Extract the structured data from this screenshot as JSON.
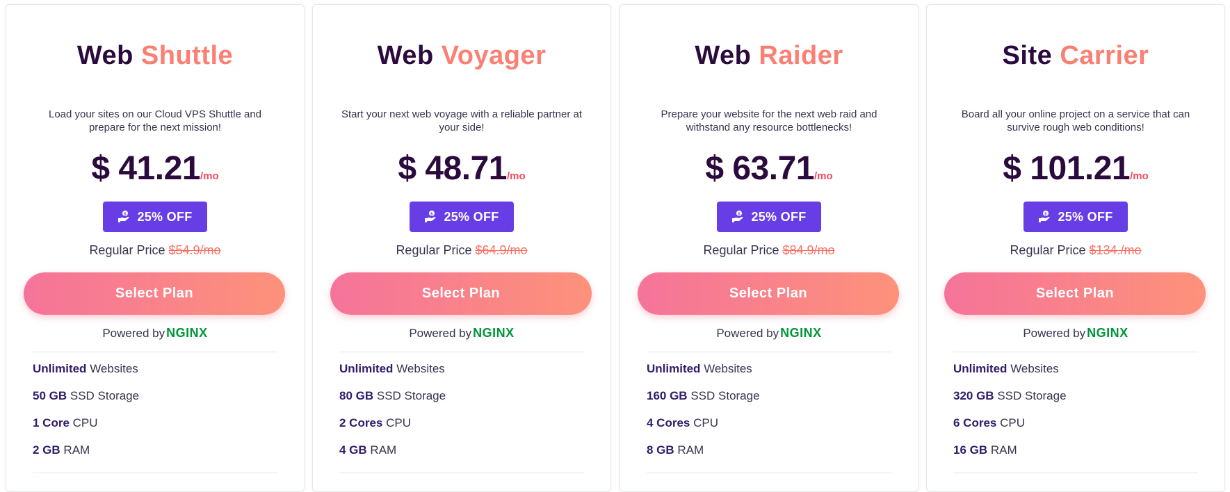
{
  "colors": {
    "title_dark": "#2b0a3d",
    "title_accent": "#fb7f72",
    "discount_bg": "#673de6",
    "select_gradient_start": "#f5739a",
    "select_gradient_end": "#fd927a",
    "nginx_green": "#009639",
    "strike_red": "#fb6f62"
  },
  "plans": [
    {
      "title_first": "Web",
      "title_accent": "Shuttle",
      "description": "Load your sites on our Cloud VPS Shuttle and prepare for the next mission!",
      "price": "$ 41.21",
      "per": "/mo",
      "discount_icon": "hand-coin-icon",
      "discount": "25% OFF",
      "regular_label": "Regular Price",
      "regular_price": "$54.9/mo",
      "select_label": "Select Plan",
      "powered_label": "Powered by",
      "powered_brand": "NGINX",
      "features": [
        {
          "strong": "Unlimited",
          "rest": "Websites"
        },
        {
          "strong": "50 GB",
          "rest": "SSD Storage"
        },
        {
          "strong": "1 Core",
          "rest": "CPU"
        },
        {
          "strong": "2 GB",
          "rest": "RAM"
        }
      ]
    },
    {
      "title_first": "Web",
      "title_accent": "Voyager",
      "description": "Start your next web voyage with a reliable partner at your side!",
      "price": "$ 48.71",
      "per": "/mo",
      "discount_icon": "hand-coin-icon",
      "discount": "25% OFF",
      "regular_label": "Regular Price",
      "regular_price": "$64.9/mo",
      "select_label": "Select Plan",
      "powered_label": "Powered by",
      "powered_brand": "NGINX",
      "features": [
        {
          "strong": "Unlimited",
          "rest": "Websites"
        },
        {
          "strong": "80 GB",
          "rest": "SSD Storage"
        },
        {
          "strong": "2 Cores",
          "rest": "CPU"
        },
        {
          "strong": "4 GB",
          "rest": "RAM"
        }
      ]
    },
    {
      "title_first": "Web",
      "title_accent": "Raider",
      "description": "Prepare your website for the next web raid and withstand any resource bottlenecks!",
      "price": "$ 63.71",
      "per": "/mo",
      "discount_icon": "hand-coin-icon",
      "discount": "25% OFF",
      "regular_label": "Regular Price",
      "regular_price": "$84.9/mo",
      "select_label": "Select Plan",
      "powered_label": "Powered by",
      "powered_brand": "NGINX",
      "features": [
        {
          "strong": "Unlimited",
          "rest": "Websites"
        },
        {
          "strong": "160 GB",
          "rest": "SSD Storage"
        },
        {
          "strong": "4 Cores",
          "rest": "CPU"
        },
        {
          "strong": "8 GB",
          "rest": "RAM"
        }
      ]
    },
    {
      "title_first": "Site",
      "title_accent": "Carrier",
      "description": "Board all your online project on a service that can survive rough web conditions!",
      "price": "$ 101.21",
      "per": "/mo",
      "discount_icon": "hand-coin-icon",
      "discount": "25% OFF",
      "regular_label": "Regular Price",
      "regular_price": "$134./mo",
      "select_label": "Select Plan",
      "powered_label": "Powered by",
      "powered_brand": "NGINX",
      "features": [
        {
          "strong": "Unlimited",
          "rest": "Websites"
        },
        {
          "strong": "320 GB",
          "rest": "SSD Storage"
        },
        {
          "strong": "6 Cores",
          "rest": "CPU"
        },
        {
          "strong": "16 GB",
          "rest": "RAM"
        }
      ]
    }
  ]
}
